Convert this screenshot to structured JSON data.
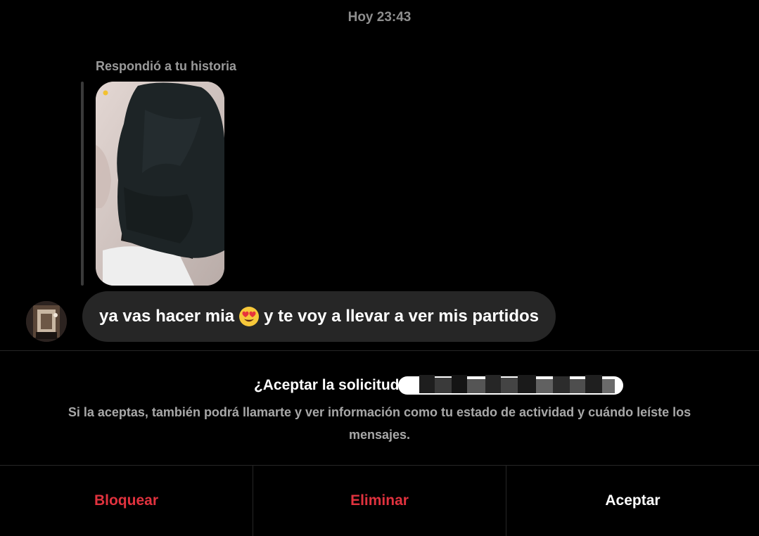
{
  "header": {
    "timestamp": "Hoy 23:43"
  },
  "message": {
    "reply_caption": "Respondió a tu historia",
    "text_before_emoji": "ya vas hacer mia",
    "emoji_icon": "heart-eyes-emoji-icon",
    "text_after_emoji": "y te voy a llevar a ver mis partidos"
  },
  "request": {
    "title_prefix": "¿Aceptar la solicitud de mensaje de",
    "description": "Si la aceptas, también podrá llamarte y ver información como tu estado de actividad y cuándo leíste los mensajes."
  },
  "actions": {
    "block_label": "Bloquear",
    "delete_label": "Eliminar",
    "accept_label": "Aceptar"
  },
  "colors": {
    "background": "#000000",
    "bubble": "#262626",
    "danger": "#e0323e",
    "muted_text": "#a8a8a8"
  }
}
